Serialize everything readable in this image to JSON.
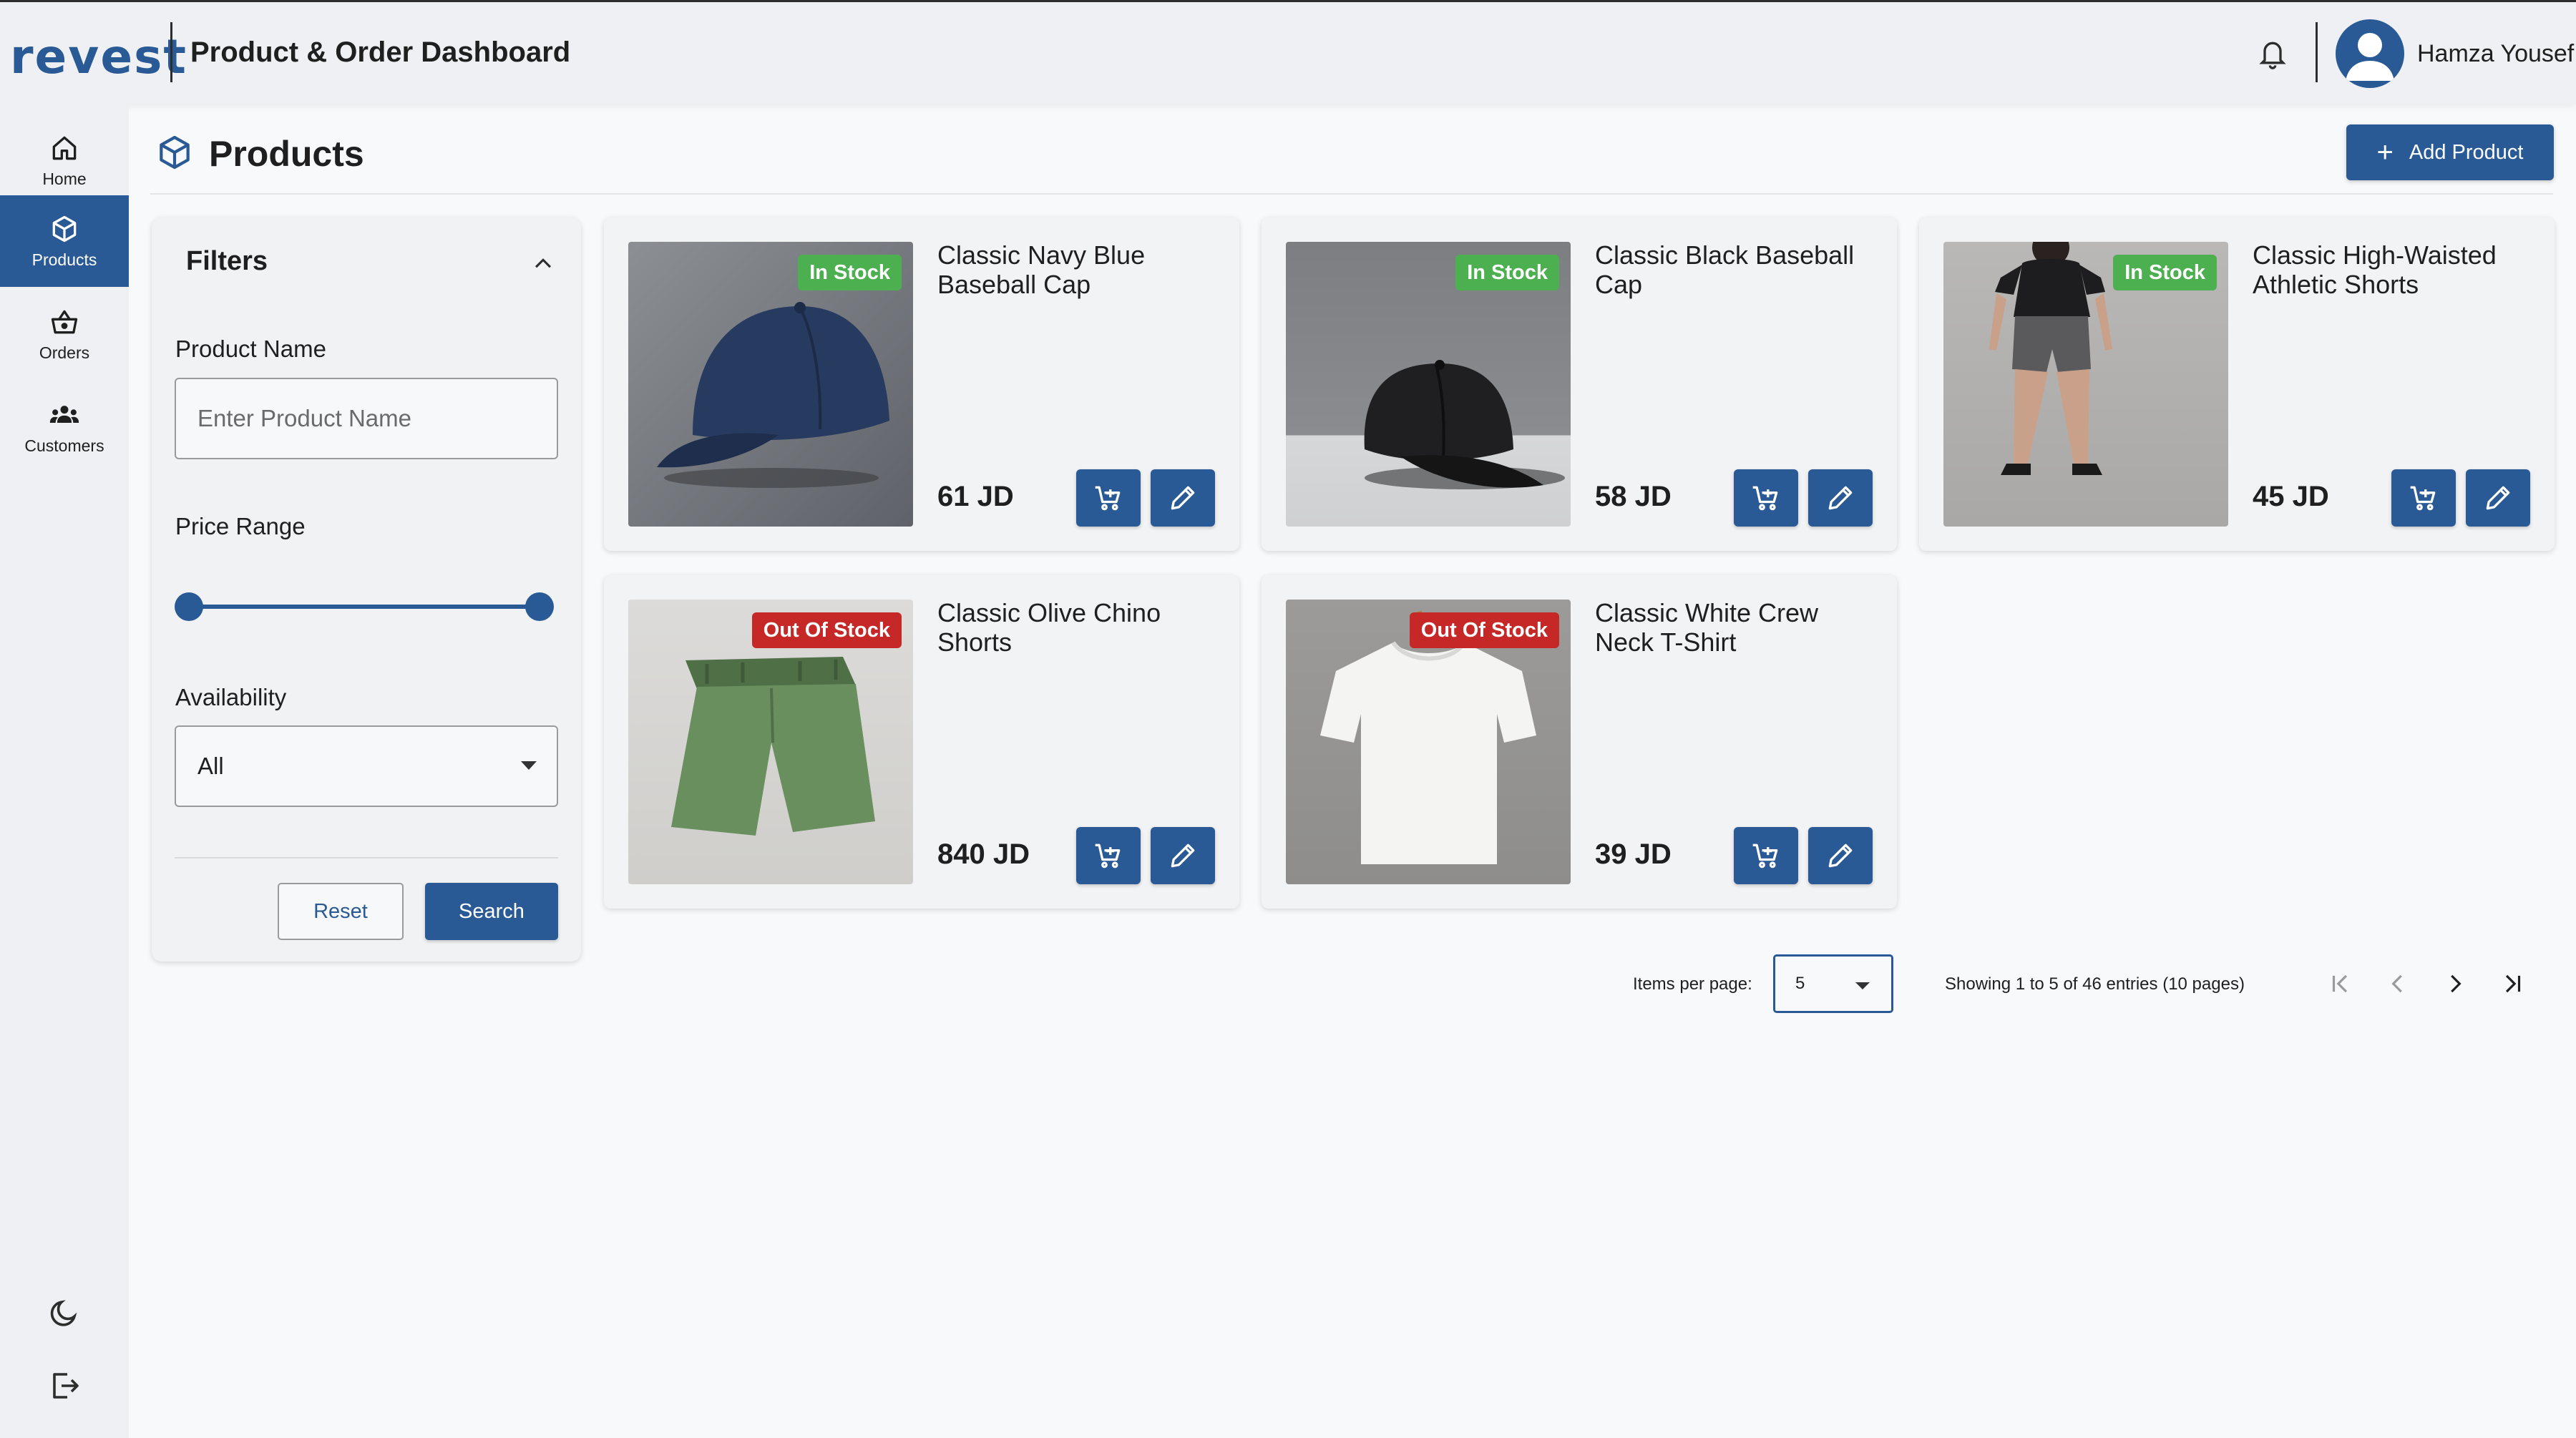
{
  "header": {
    "logo": "revest",
    "title": "Product & Order Dashboard",
    "user_name": "Hamza Yousef"
  },
  "sidebar": {
    "items": [
      {
        "label": "Home",
        "icon": "home-icon"
      },
      {
        "label": "Products",
        "icon": "box-icon",
        "active": true
      },
      {
        "label": "Orders",
        "icon": "basket-icon"
      },
      {
        "label": "Customers",
        "icon": "people-icon"
      }
    ],
    "bottom_icons": [
      "moon-icon",
      "logout-icon"
    ]
  },
  "page": {
    "title": "Products",
    "add_button": "Add Product"
  },
  "filters": {
    "title": "Filters",
    "product_name_label": "Product Name",
    "product_name_placeholder": "Enter Product Name",
    "price_range_label": "Price Range",
    "price_range": {
      "min_fraction": 0,
      "max_fraction": 1
    },
    "availability_label": "Availability",
    "availability_value": "All",
    "reset_label": "Reset",
    "search_label": "Search"
  },
  "products": [
    {
      "name": "Classic Navy Blue Baseball Cap",
      "price": "61 JD",
      "status": "In Stock",
      "in_stock": true,
      "image": "navy-cap"
    },
    {
      "name": "Classic Black Baseball Cap",
      "price": "58 JD",
      "status": "In Stock",
      "in_stock": true,
      "image": "black-cap"
    },
    {
      "name": "Classic High-Waisted Athletic Shorts",
      "price": "45 JD",
      "status": "In Stock",
      "in_stock": true,
      "image": "athletic-shorts"
    },
    {
      "name": "Classic Olive Chino Shorts",
      "price": "840 JD",
      "status": "Out Of Stock",
      "in_stock": false,
      "image": "olive-shorts"
    },
    {
      "name": "Classic White Crew Neck T-Shirt",
      "price": "39 JD",
      "status": "Out Of Stock",
      "in_stock": false,
      "image": "white-tshirt"
    }
  ],
  "pagination": {
    "items_per_page_label": "Items per page:",
    "items_per_page": "5",
    "showing": "Showing 1 to 5 of 46 entries (10 pages)"
  },
  "colors": {
    "primary": "#2a5a95",
    "in_stock": "#4caf50",
    "out_of_stock": "#c62828"
  }
}
